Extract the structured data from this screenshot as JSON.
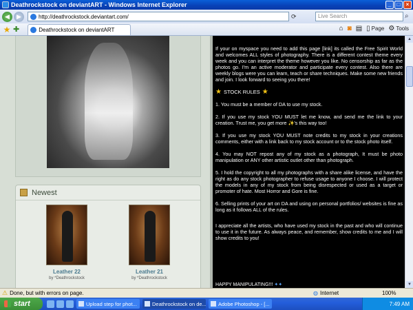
{
  "window": {
    "title": "Deathrockstock on deviantART - Windows Internet Explorer"
  },
  "address_bar": {
    "url": "http://deathrockstock.deviantart.com/",
    "search_placeholder": "Live Search"
  },
  "tabs": [
    {
      "label": "Deathrockstock on deviantART"
    }
  ],
  "commands": {
    "page": "Page",
    "tools": "Tools"
  },
  "newest": {
    "heading": "Newest",
    "items": [
      {
        "title": "Leather 22",
        "by": "by *Deathrockstock"
      },
      {
        "title": "Leather 21",
        "by": "by *Deathrockstock"
      }
    ]
  },
  "description": {
    "intro": "If your on myspace you need to add this page [link] its called the Free Spirit World and welcomes ALL styles of photography. There is a different contest theme every week and you can interpret the theme however you like. No censorship as far as the photos go. I'm an active moderator and participate every contest. Also there are weekly blogs were you can learn, teach or share techniques. Make some new friends and join. I look forward to seeing you there!",
    "rules_heading": "STOCK RULES",
    "rules": [
      "1. You must be a member of DA to use my stock.",
      "2. If you use my stock YOU MUST let me know, and send me the link to your creation. Trust me, you get more ✨'s this way too!",
      "3. If you use my stock YOU MUST note credits to my stock in your creations comments, either with a link back to my stock account or to the stock photo itself.",
      "4. You may NOT repost any of my stock as a photograph, It must be photo manipulation or ANY other artistic outlet other than photograph.",
      "5. I hold the copyright to all my photographs with a share alike license, and have the right as do any stock photographer to refuse usage to anyone I choose. I will protect the models in any of my stock from being disrespected or used as a target or promoter of hate. Most Horror and Gore is fine.",
      "6. Selling prints of your art on DA and using on personal portfolios/ websites is fine as long as it follows ALL of the rules."
    ],
    "closing": "I appreciate all the artists, who have used my stock in the past and who will continue to use it in the future. As always peace, and remember, show credits to me and I will show credits to you!",
    "sign_off": "HAPPY MANIPULATING!!!"
  },
  "status_bar": {
    "message": "Done, but with errors on page.",
    "zone": "Internet",
    "zoom": "100%"
  },
  "taskbar": {
    "start": "start",
    "tasks": [
      {
        "label": "Upload step for phot..."
      },
      {
        "label": "Deathrockstock on de..."
      },
      {
        "label": "Adobe Photoshop - [..."
      }
    ],
    "clock": "7:49 AM"
  }
}
